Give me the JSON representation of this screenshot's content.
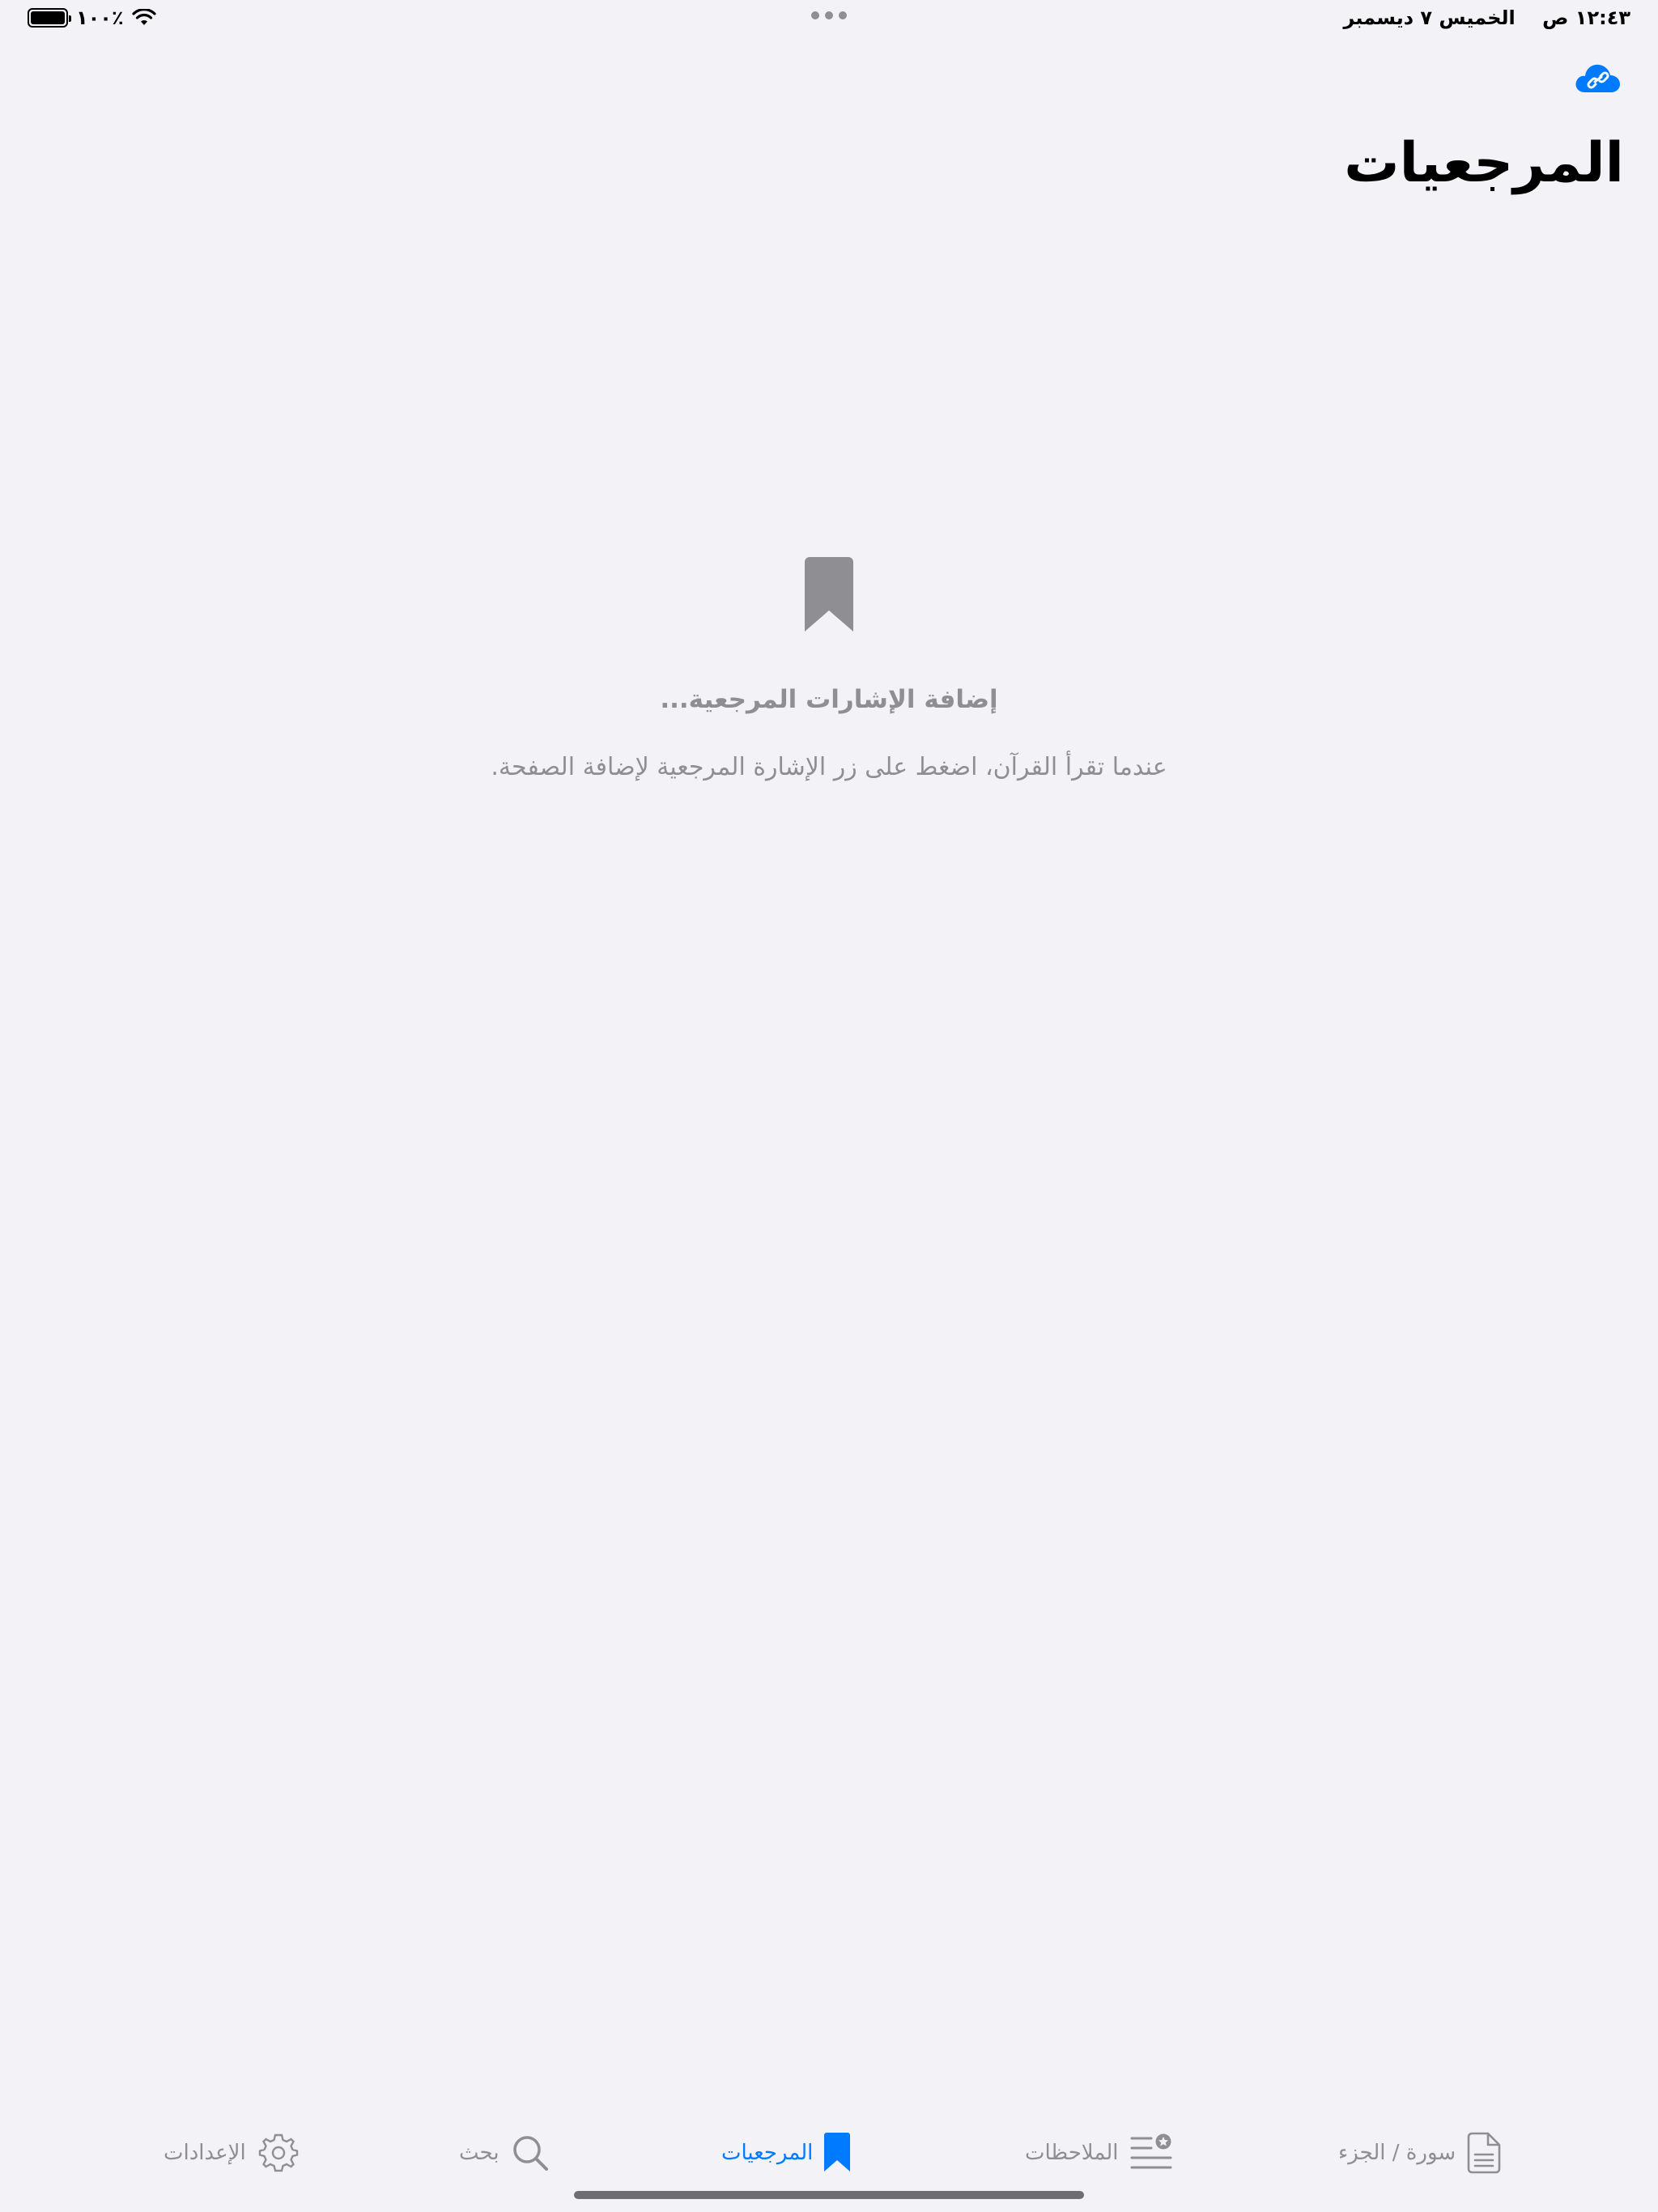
{
  "status_bar": {
    "time": "١٢:٤٣ ص",
    "date": "الخميس ٧ ديسمبر",
    "battery": "١٠٠٪"
  },
  "header": {
    "title": "المرجعيات",
    "cloud_icon": "cloud-link-icon"
  },
  "empty_state": {
    "icon": "bookmark-icon",
    "heading": "إضافة الإشارات المرجعية...",
    "body": "عندما تقرأ القرآن، اضغط على زر الإشارة المرجعية لإضافة الصفحة."
  },
  "tabs": [
    {
      "label": "سورة / الجزء",
      "icon": "document-icon",
      "active": false
    },
    {
      "label": "الملاحظات",
      "icon": "notes-star-icon",
      "active": false
    },
    {
      "label": "المرجعيات",
      "icon": "bookmark-icon",
      "active": true
    },
    {
      "label": "بحث",
      "icon": "search-icon",
      "active": false
    },
    {
      "label": "الإعدادات",
      "icon": "gear-icon",
      "active": false
    }
  ],
  "colors": {
    "accent": "#007aff",
    "secondary": "#8e8e93",
    "background": "#f2f2f7"
  }
}
